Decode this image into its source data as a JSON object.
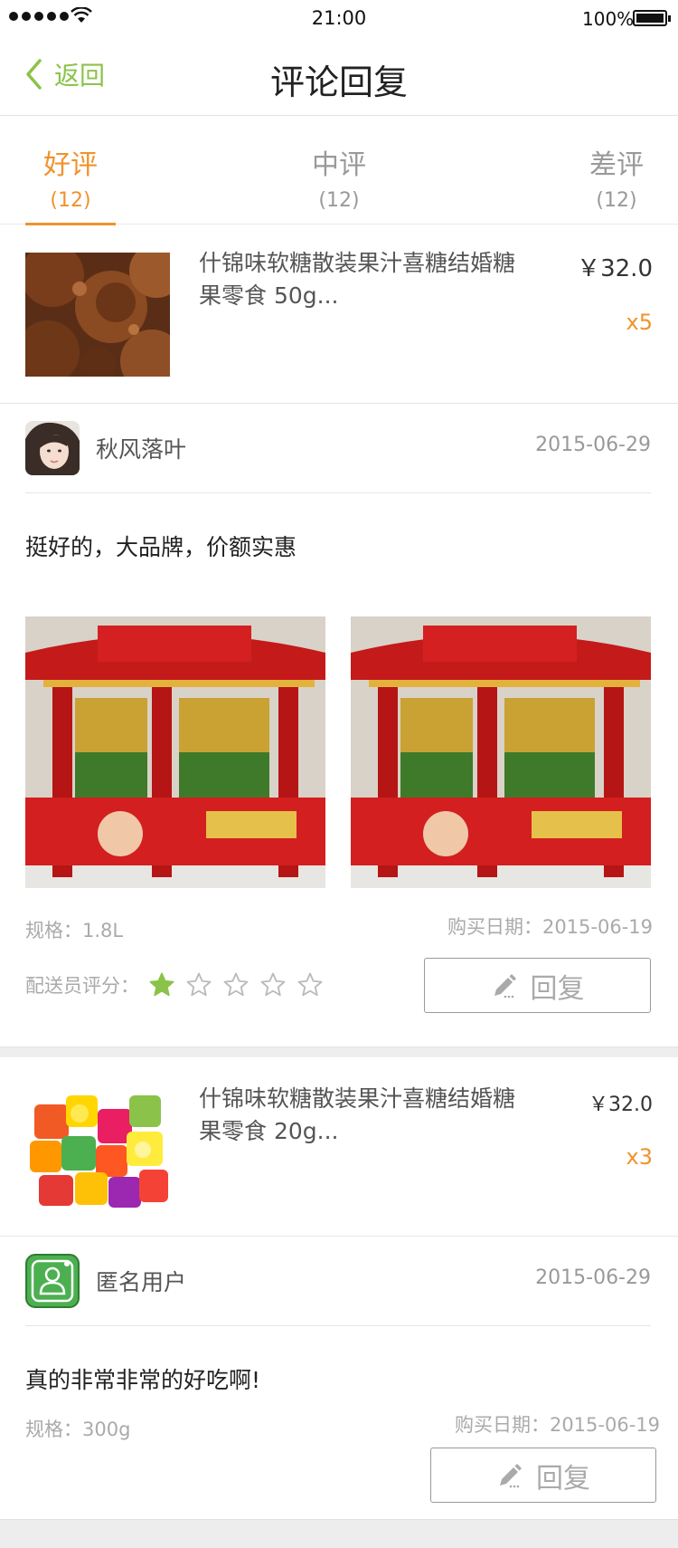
{
  "status_bar": {
    "time": "21:00",
    "battery": "100%"
  },
  "nav": {
    "back_label": "返回",
    "title": "评论回复"
  },
  "tabs": [
    {
      "label": "好评",
      "count": "(12)",
      "active": true
    },
    {
      "label": "中评",
      "count": "(12)",
      "active": false
    },
    {
      "label": "差评",
      "count": "(12)",
      "active": false
    }
  ],
  "reviews": [
    {
      "product": {
        "name": "什锦味软糖散装果汁喜糖结婚糖果零食 50g...",
        "price": "￥32.0",
        "qty": "x5"
      },
      "user": {
        "name": "秋风落叶",
        "date": "2015-06-29"
      },
      "comment": "挺好的，大品牌，价额实惠",
      "spec": "规格：1.8L",
      "purchase_date": "购买日期：2015-06-19",
      "courier_rating_label": "配送员评分：",
      "courier_rating": 1,
      "courier_rating_max": 5,
      "reply_label": "回复"
    },
    {
      "product": {
        "name": "什锦味软糖散装果汁喜糖结婚糖果零食 20g...",
        "price": "￥32.0",
        "qty": "x3"
      },
      "user": {
        "name": "匿名用户",
        "date": "2015-06-29"
      },
      "comment": "真的非常非常的好吃啊!",
      "spec": "规格：300g",
      "purchase_date": "购买日期：2015-06-19",
      "reply_label": "回复"
    }
  ],
  "colors": {
    "accent": "#f0932b",
    "green": "#8bc34a"
  }
}
